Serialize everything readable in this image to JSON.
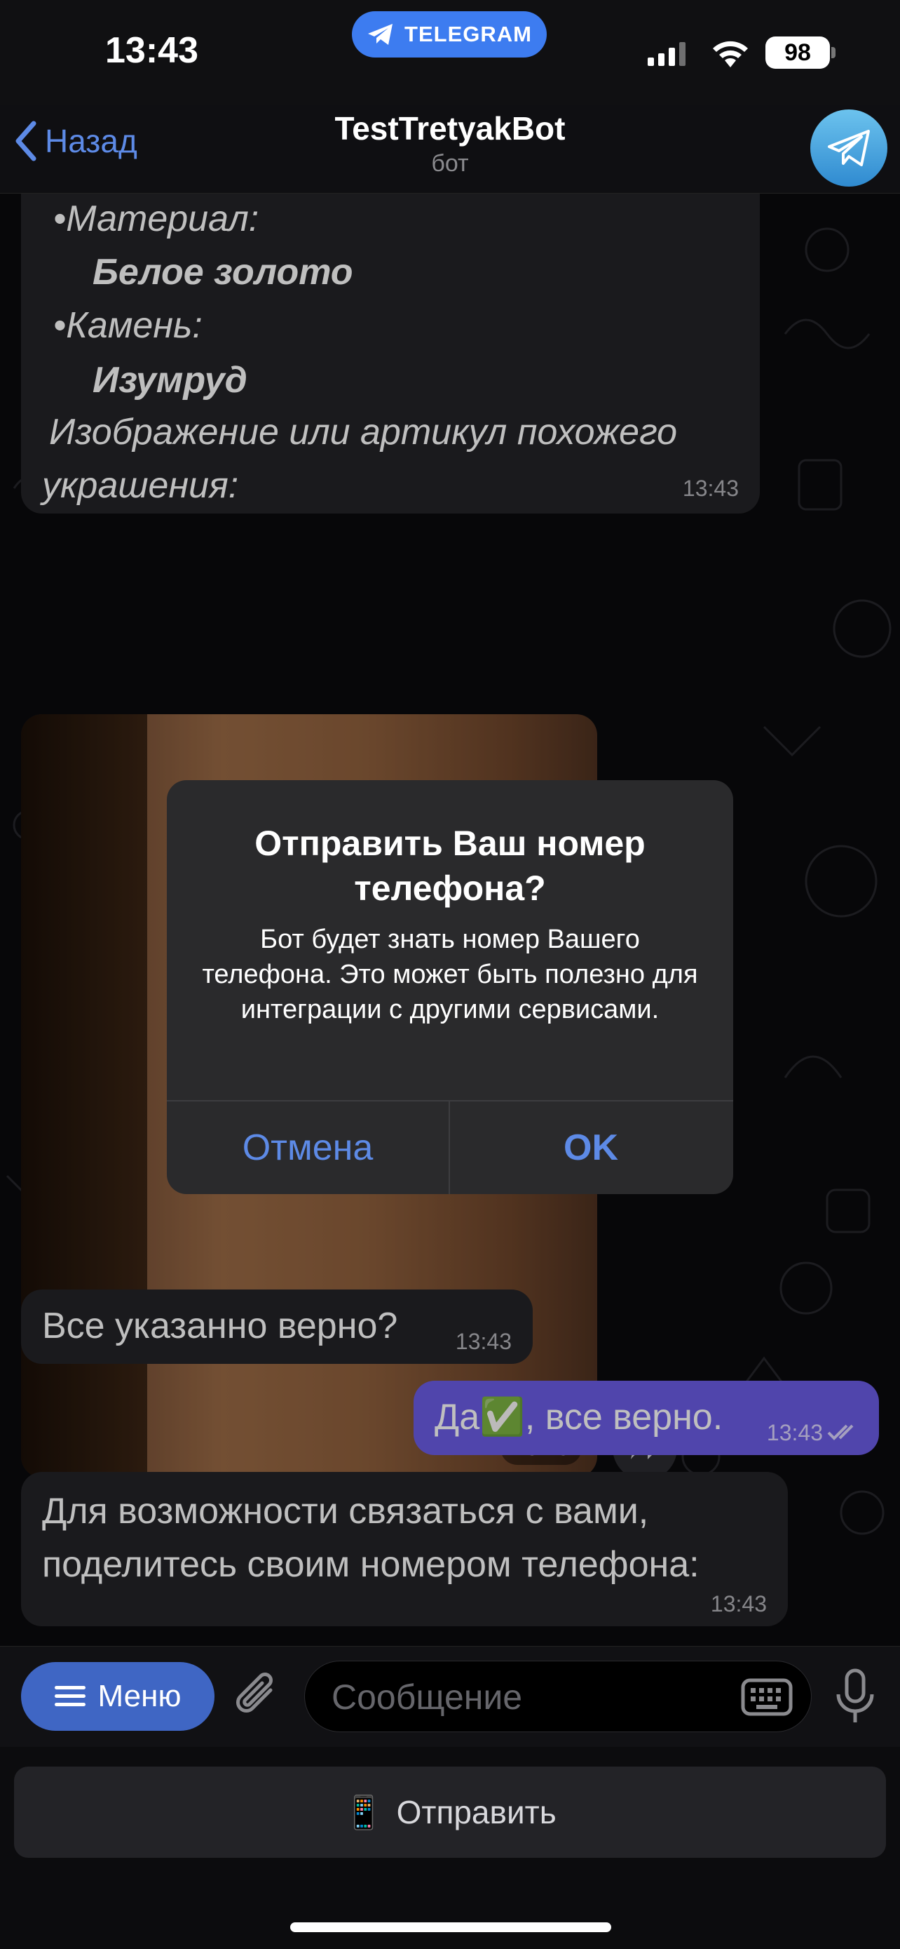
{
  "status_bar": {
    "time": "13:43",
    "app_pill": "TELEGRAM",
    "battery": "98"
  },
  "nav": {
    "back_label": "Назад",
    "title": "TestTretyakBot",
    "subtitle": "бот"
  },
  "messages": {
    "order_details": {
      "material_label": "•Материал:",
      "material_value": "Белое золото",
      "stone_label": "•Камень:",
      "stone_value": "Изумруд",
      "image_line1": "Изображение или артикул похожего",
      "image_line2": "украшения:",
      "time": "13:43"
    },
    "photo": {
      "time": "13:43"
    },
    "confirm_question": {
      "text": "Все указанно верно?",
      "time": "13:43"
    },
    "user_reply": {
      "text": "Да✅, все верно.",
      "time": "13:43"
    },
    "share_request": {
      "line1": "Для возможности связаться с вами,",
      "line2": "поделитесь своим номером телефона:",
      "time": "13:43"
    }
  },
  "alert": {
    "title": "Отправить Ваш номер телефона?",
    "message": "Бот будет знать номер Вашего телефона. Это может быть полезно для интеграции с другими сервисами.",
    "cancel_label": "Отмена",
    "ok_label": "OK"
  },
  "composer": {
    "menu_label": "Меню",
    "placeholder": "Сообщение"
  },
  "reply_keyboard": {
    "send_icon": "📱",
    "send_label": "Отправить"
  },
  "colors": {
    "accent": "#5d8ae6",
    "outgoing_bubble": "#6b5ce6",
    "incoming_bubble": "#232327",
    "telegram_pill": "#3d7cf0"
  }
}
